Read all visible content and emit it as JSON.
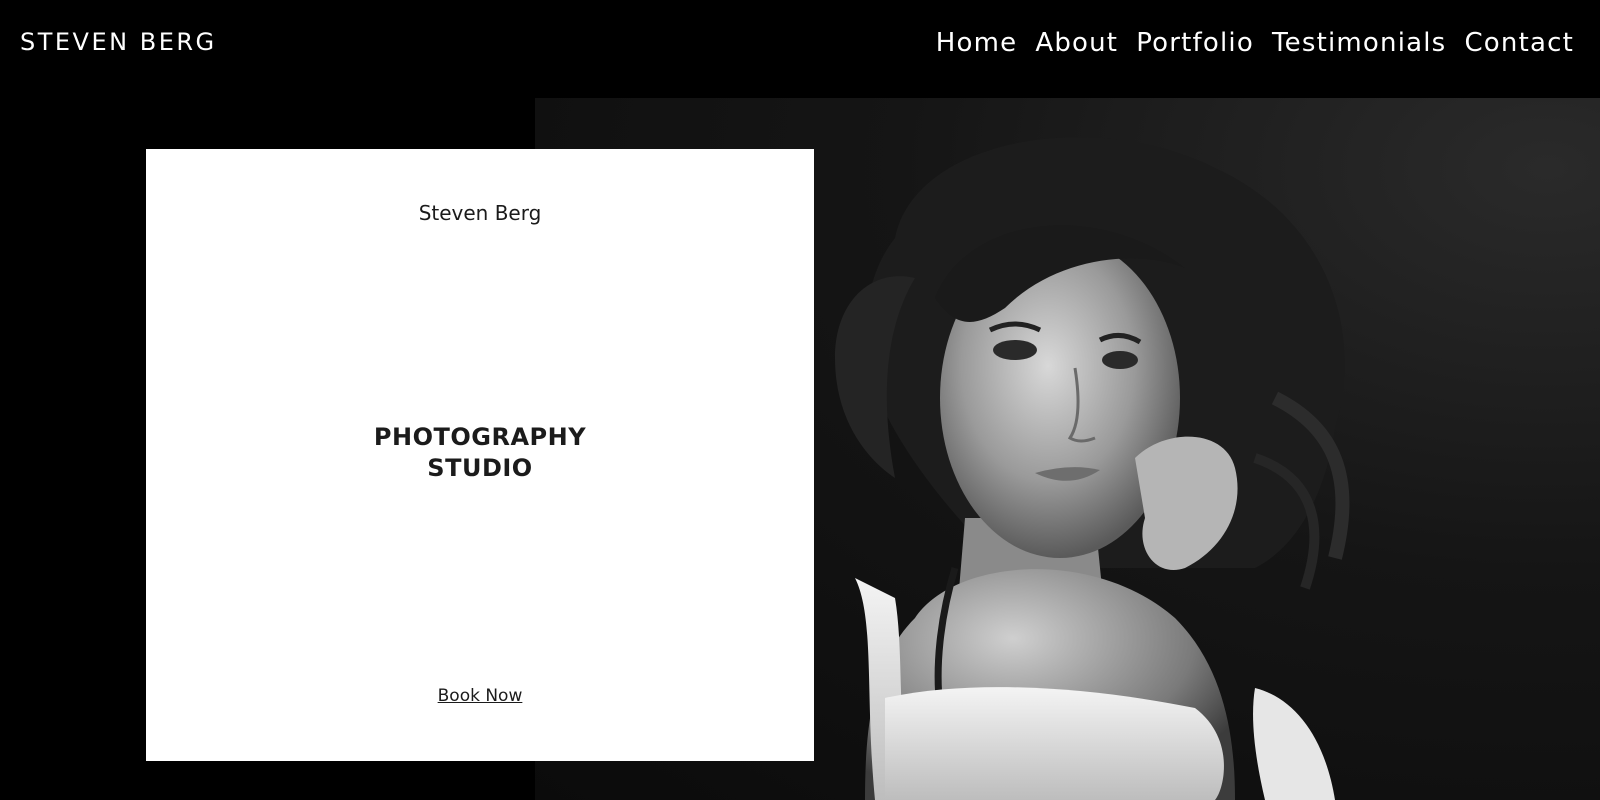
{
  "header": {
    "brand": "STEVEN BERG",
    "nav": [
      {
        "label": "Home"
      },
      {
        "label": "About"
      },
      {
        "label": "Portfolio"
      },
      {
        "label": "Testimonials"
      },
      {
        "label": "Contact"
      }
    ]
  },
  "card": {
    "name": "Steven Berg",
    "title_line1": "PHOTOGRAPHY",
    "title_line2": "STUDIO",
    "cta": "Book Now"
  },
  "colors": {
    "background": "#000000",
    "card": "#ffffff",
    "text_light": "#ffffff",
    "text_dark": "#1b1b1b"
  }
}
